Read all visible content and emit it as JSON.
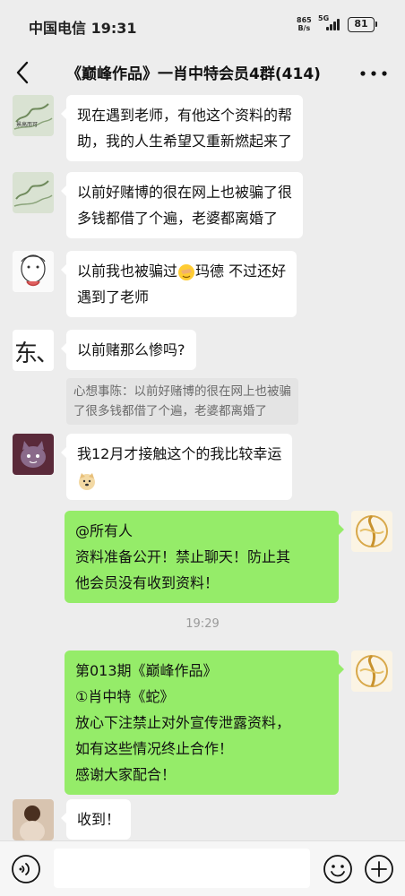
{
  "status_bar": {
    "carrier_time": "中国电信 19:31",
    "net_speed_value": "865",
    "net_speed_unit": "B/s",
    "network": "5G",
    "battery": "81"
  },
  "nav": {
    "title": "《巅峰作品》一肖中特会员4群(414)"
  },
  "messages": [
    {
      "side": "left",
      "lines": [
        "现在遇到老师，有他这个资料的帮",
        "助，我的人生希望又重新燃起来了"
      ],
      "avatar_label": "景高而可"
    },
    {
      "side": "left",
      "lines": [
        "以前好赌博的很在网上也被骗了很",
        "多钱都借了个遍，老婆都离婚了"
      ]
    },
    {
      "side": "left",
      "line1_a": "以前我也被骗过",
      "line1_b": "玛德 不过还好",
      "line2": "遇到了老师"
    },
    {
      "side": "left",
      "lines": [
        "以前赌那么惨吗?"
      ],
      "avatar_label": "东、",
      "quote_lines": [
        "心想事陈：以前好赌博的很在网上也被骗",
        "了很多钱都借了个遍，老婆都离婚了"
      ]
    },
    {
      "side": "left",
      "lines": [
        "我12月才接触这个的我比较幸运"
      ]
    },
    {
      "side": "right",
      "lines": [
        "@所有人",
        "资料准备公开！禁止聊天！防止其",
        "他会员没有收到资料！"
      ]
    },
    {
      "side": "right",
      "lines": [
        "第013期《巅峰作品》",
        "①肖中特《蛇》",
        "放心下注禁止对外宣传泄露资料，",
        "如有这些情况终止合作！",
        "感谢大家配合！"
      ]
    },
    {
      "side": "left",
      "lines": [
        "收到！"
      ]
    }
  ],
  "timestamp": "19:29",
  "icons": {
    "back": "back-arrow-icon",
    "more": "more-dots-icon",
    "voice": "voice-input-icon",
    "emoji": "emoji-icon",
    "plus": "plus-icon"
  },
  "colors": {
    "background": "#ededed",
    "bubble_self": "#95ec69",
    "bubble_other": "#ffffff"
  }
}
